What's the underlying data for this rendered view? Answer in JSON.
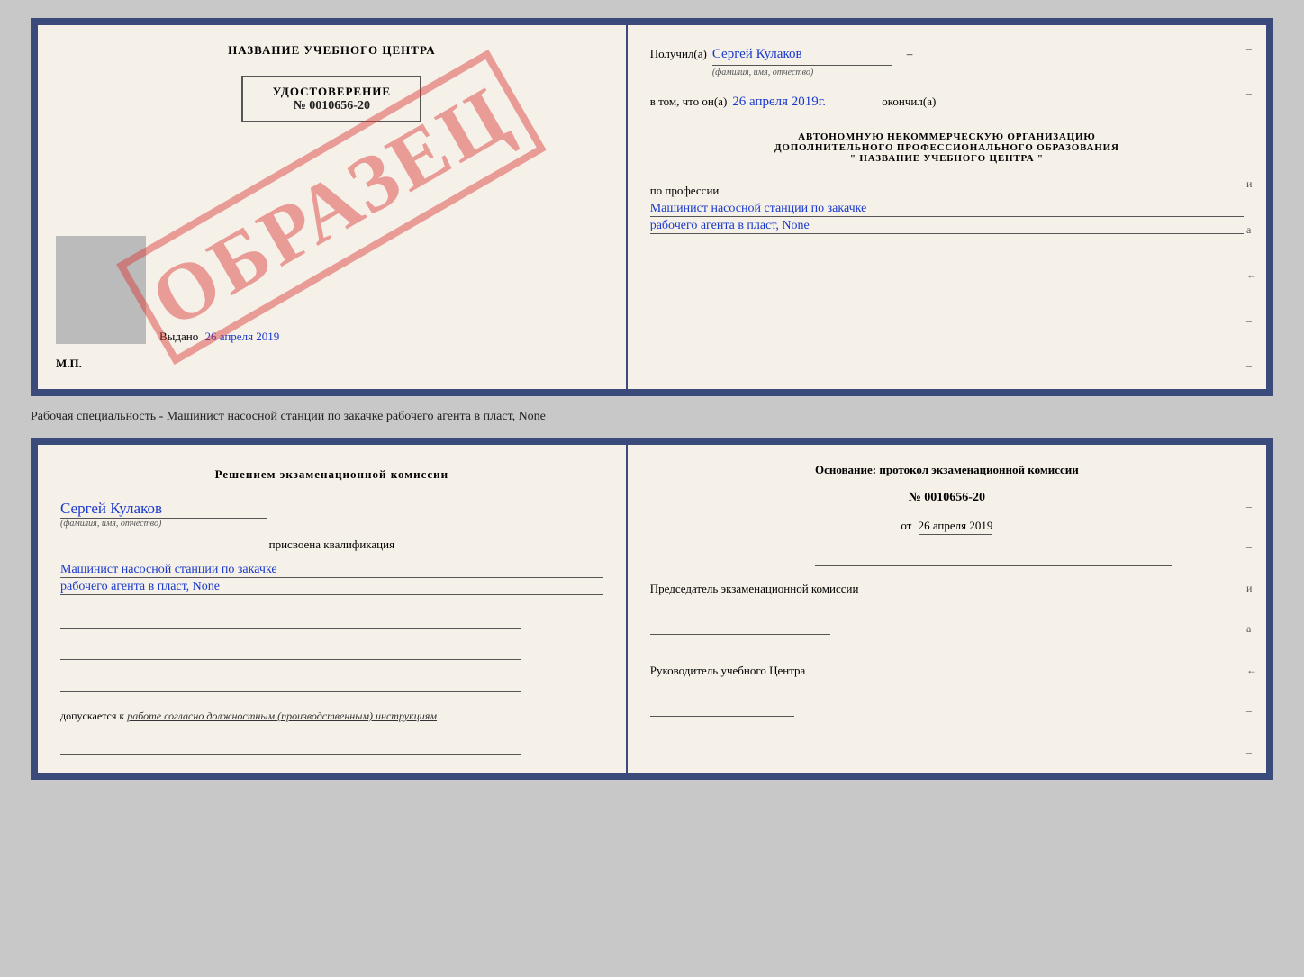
{
  "top_left": {
    "center_title": "НАЗВАНИЕ УЧЕБНОГО ЦЕНТРА",
    "udostoverenie_label": "УДОСТОВЕРЕНИЕ",
    "udostoverenie_number": "№ 0010656-20",
    "photo_alt": "фото",
    "vydano_label": "Выдано",
    "vydano_date": "26 апреля 2019",
    "mp_label": "М.П.",
    "watermark": "ОБРАЗЕЦ"
  },
  "top_right": {
    "poluchil_label": "Получил(а)",
    "poluchil_name": "Сергей Кулаков",
    "familiya_label": "(фамилия, имя, отчество)",
    "dash1": "–",
    "vtom_label": "в том, что он(а)",
    "date_value": "26 апреля 2019г.",
    "okonchil_label": "окончил(а)",
    "org_line1": "АВТОНОМНУЮ НЕКОММЕРЧЕСКУЮ ОРГАНИЗАЦИЮ",
    "org_line2": "ДОПОЛНИТЕЛЬНОГО ПРОФЕССИОНАЛЬНОГО ОБРАЗОВАНИЯ",
    "org_line3": "\" НАЗВАНИЕ УЧЕБНОГО ЦЕНТРА \"",
    "po_professii": "по профессии",
    "profession1": "Машинист насосной станции по закачке",
    "profession2": "рабочего агента в пласт, None"
  },
  "middle_text": "Рабочая специальность - Машинист насосной станции по закачке рабочего агента в пласт, None",
  "bottom_left": {
    "komissia_title": "Решением  экзаменационной  комиссии",
    "name_handwritten": "Сергей Кулаков",
    "familiya_label": "(фамилия, имя, отчество)",
    "prisvoena_label": "присвоена квалификация",
    "profession1": "Машинист насосной станции по закачке",
    "profession2": "рабочего агента в пласт, None",
    "dopuskaetsya_label": "допускается к",
    "dopuskaetsya_text": "работе согласно должностным (производственным) инструкциям"
  },
  "bottom_right": {
    "osnovanie_title": "Основание: протокол экзаменационной комиссии",
    "number_label": "№ 0010656-20",
    "ot_label": "от",
    "ot_date": "26 апреля 2019",
    "predsedatel_title": "Председатель экзаменационной комиссии",
    "rukovoditel_title": "Руководитель учебного Центра"
  },
  "dashes": {
    "right_side": [
      "–",
      "–",
      "–",
      "и",
      "а",
      "←",
      "–",
      "–"
    ]
  }
}
